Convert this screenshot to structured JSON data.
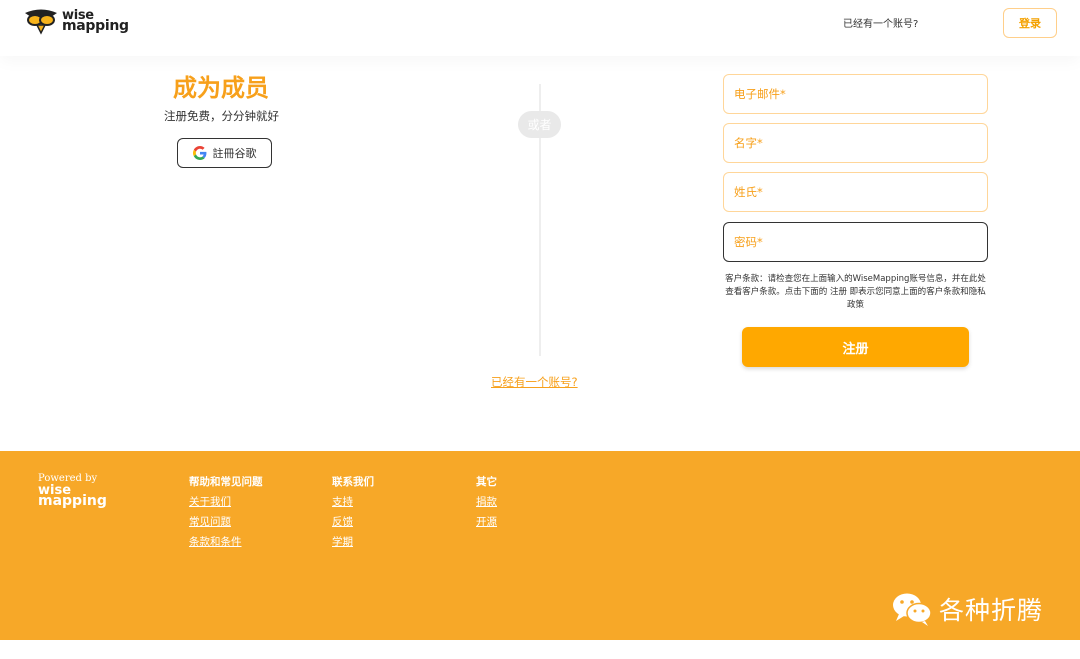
{
  "header": {
    "logo_line1": "wise",
    "logo_line2": "mapping",
    "question": "已经有一个账号?",
    "login_label": "登录"
  },
  "signup": {
    "title": "成为成员",
    "subtitle": "注册免费，分分钟就好",
    "google_label": "註冊谷歌",
    "or_label": "或者",
    "have_account_link": "已经有一个账号?"
  },
  "form": {
    "email_placeholder": "电子邮件*",
    "first_name_placeholder": "名字*",
    "last_name_placeholder": "姓氏*",
    "password_placeholder": "密码*",
    "terms_text": "客户条款：请检查您在上面输入的WiseMapping账号信息，并在此处查看客户条款。点击下面的 注册 即表示您同意上面的客户条款和隐私政策",
    "register_label": "注册"
  },
  "footer": {
    "powered_by": "Powered by",
    "logo_line1": "wise",
    "logo_line2": "mapping",
    "columns": [
      {
        "heading": "帮助和常见问题",
        "links": [
          "关于我们",
          "常见问题",
          "条款和条件"
        ]
      },
      {
        "heading": "联系我们",
        "links": [
          "支持",
          "反馈",
          "学期"
        ]
      },
      {
        "heading": "其它",
        "links": [
          "捐款",
          "开源"
        ]
      }
    ],
    "watermark": "各种折腾"
  },
  "colors": {
    "accent": "#f7a01b",
    "footer_bg": "#f7a828",
    "button_bg": "#ffa800"
  }
}
